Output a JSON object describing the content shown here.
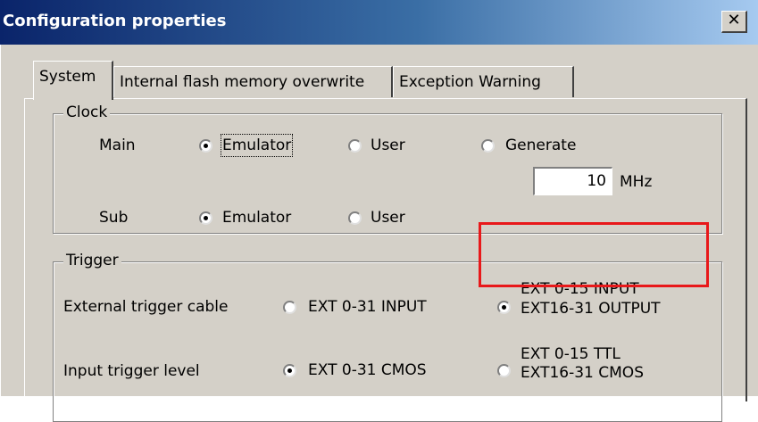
{
  "window": {
    "title": "Configuration properties",
    "close_glyph": "✕"
  },
  "tabs": [
    {
      "label": "System",
      "active": true
    },
    {
      "label": "Internal flash memory overwrite",
      "active": false
    },
    {
      "label": "Exception Warning",
      "active": false
    }
  ],
  "clock": {
    "legend": "Clock",
    "main": {
      "label": "Main",
      "options": [
        "Emulator",
        "User",
        "Generate"
      ],
      "selected": "Emulator"
    },
    "frequency": {
      "value": "10",
      "unit": "MHz"
    },
    "sub": {
      "label": "Sub",
      "options": [
        "Emulator",
        "User"
      ],
      "selected": "Emulator"
    }
  },
  "trigger": {
    "legend": "Trigger",
    "external_cable": {
      "label": "External trigger cable",
      "option1": "EXT 0-31  INPUT",
      "option2_line1": "EXT 0-15  INPUT",
      "option2_line2": "EXT16-31  OUTPUT",
      "selected": 2
    },
    "input_level": {
      "label": "Input trigger level",
      "option1": "EXT 0-31  CMOS",
      "option2_line1": "EXT 0-15  TTL",
      "option2_line2": "EXT16-31  CMOS",
      "selected": 1
    }
  },
  "colors": {
    "highlight": "#e8181a",
    "title_start": "#0a246a",
    "title_end": "#a6caf0",
    "face": "#d4d0c8"
  }
}
